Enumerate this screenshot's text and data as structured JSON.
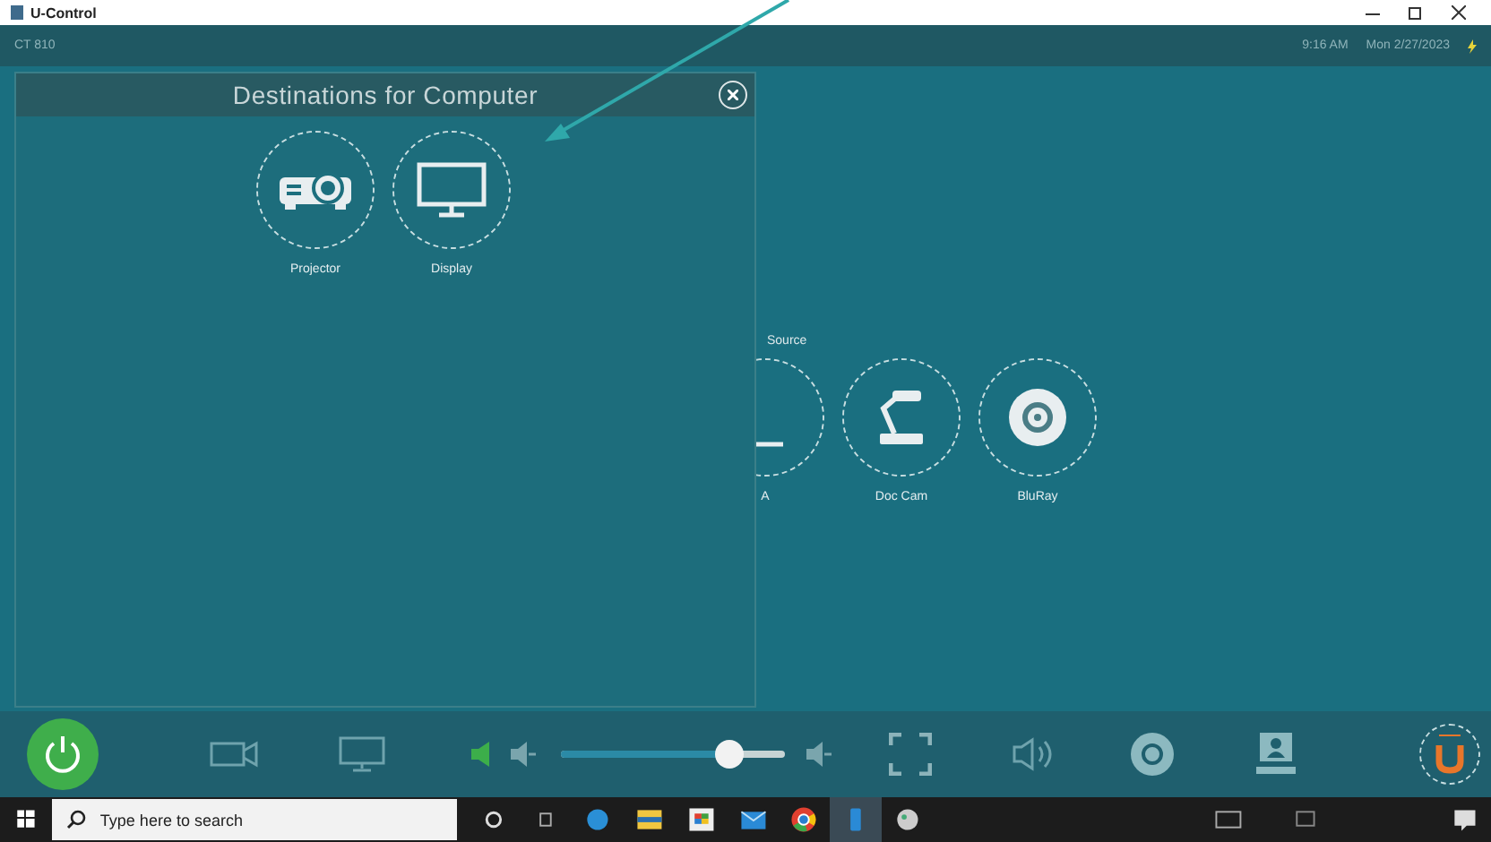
{
  "window": {
    "title": "U-Control"
  },
  "header": {
    "room": "CT 810",
    "time": "9:16 AM",
    "date": "Mon 2/27/2023"
  },
  "sources": {
    "heading": "Source",
    "items": [
      {
        "label": "A",
        "kind": "laptop"
      },
      {
        "label": "Doc Cam",
        "kind": "doccam"
      },
      {
        "label": "BluRay",
        "kind": "disc"
      }
    ]
  },
  "dialog": {
    "title": "Destinations for Computer",
    "destinations": [
      {
        "label": "Projector",
        "kind": "projector"
      },
      {
        "label": "Display",
        "kind": "display"
      }
    ]
  },
  "volume": {
    "muted": true,
    "level": 0.75
  },
  "taskbar": {
    "search": {
      "placeholder": "Type here to search"
    }
  }
}
